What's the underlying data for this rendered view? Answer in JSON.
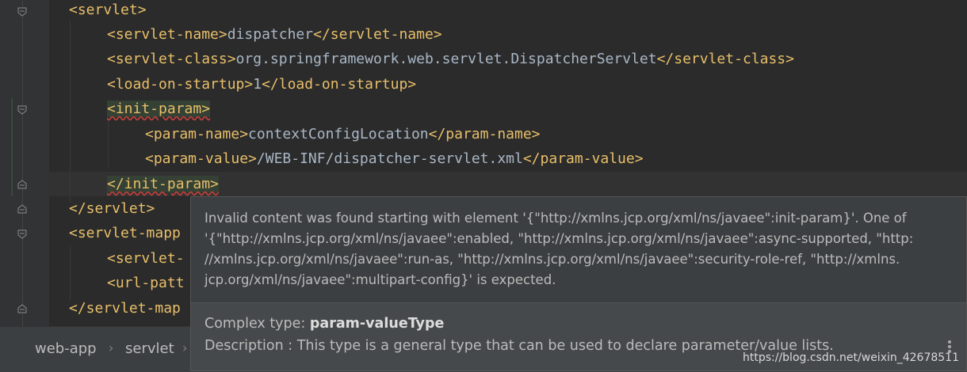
{
  "editor": {
    "lines": [
      {
        "open": "<servlet>",
        "text": "",
        "close": ""
      },
      {
        "open": "<servlet-name>",
        "text": "dispatcher",
        "close": "</servlet-name>"
      },
      {
        "open": "<servlet-class>",
        "text": "org.springframework.web.servlet.DispatcherServlet",
        "close": "</servlet-class>"
      },
      {
        "open": "<load-on-startup>",
        "text": "1",
        "close": "</load-on-startup>"
      },
      {
        "open": "<init-param>",
        "text": "",
        "close": ""
      },
      {
        "open": "<param-name>",
        "text": "contextConfigLocation",
        "close": "</param-name>"
      },
      {
        "open": "<param-value>",
        "text": "/WEB-INF/dispatcher-servlet.xml",
        "close": "</param-value>"
      },
      {
        "open": "</init-param>",
        "text": "",
        "close": ""
      },
      {
        "open": "</servlet>",
        "text": "",
        "close": ""
      },
      {
        "open": "<servlet-mapp",
        "text": "",
        "close": ""
      },
      {
        "open": "<servlet-",
        "text": "",
        "close": ""
      },
      {
        "open": "<url-patt",
        "text": "",
        "close": ""
      },
      {
        "open": "</servlet-map",
        "text": "",
        "close": ""
      }
    ]
  },
  "tooltip": {
    "message_lines": [
      "Invalid content was found starting with element '{\"http://xmlns.jcp.org/xml/ns/javaee\":init-param}'. One of",
      "'{\"http://xmlns.jcp.org/xml/ns/javaee\":enabled, \"http://xmlns.jcp.org/xml/ns/javaee\":async-supported, \"http:",
      "//xmlns.jcp.org/xml/ns/javaee\":run-as, \"http://xmlns.jcp.org/xml/ns/javaee\":security-role-ref, \"http://xmlns.",
      "jcp.org/xml/ns/javaee\":multipart-config}' is expected."
    ],
    "type_label": "Complex type: ",
    "type_value": "param-valueType",
    "description": "Description : This type is a general type that can be used to declare parameter/value lists."
  },
  "breadcrumb": {
    "items": [
      "web-app",
      "servlet"
    ],
    "separator": "›"
  },
  "watermark": "https://blog.csdn.net/weixin_42678511",
  "icons": {
    "fold": "fold-marker-icon",
    "more": "more-options-icon"
  }
}
